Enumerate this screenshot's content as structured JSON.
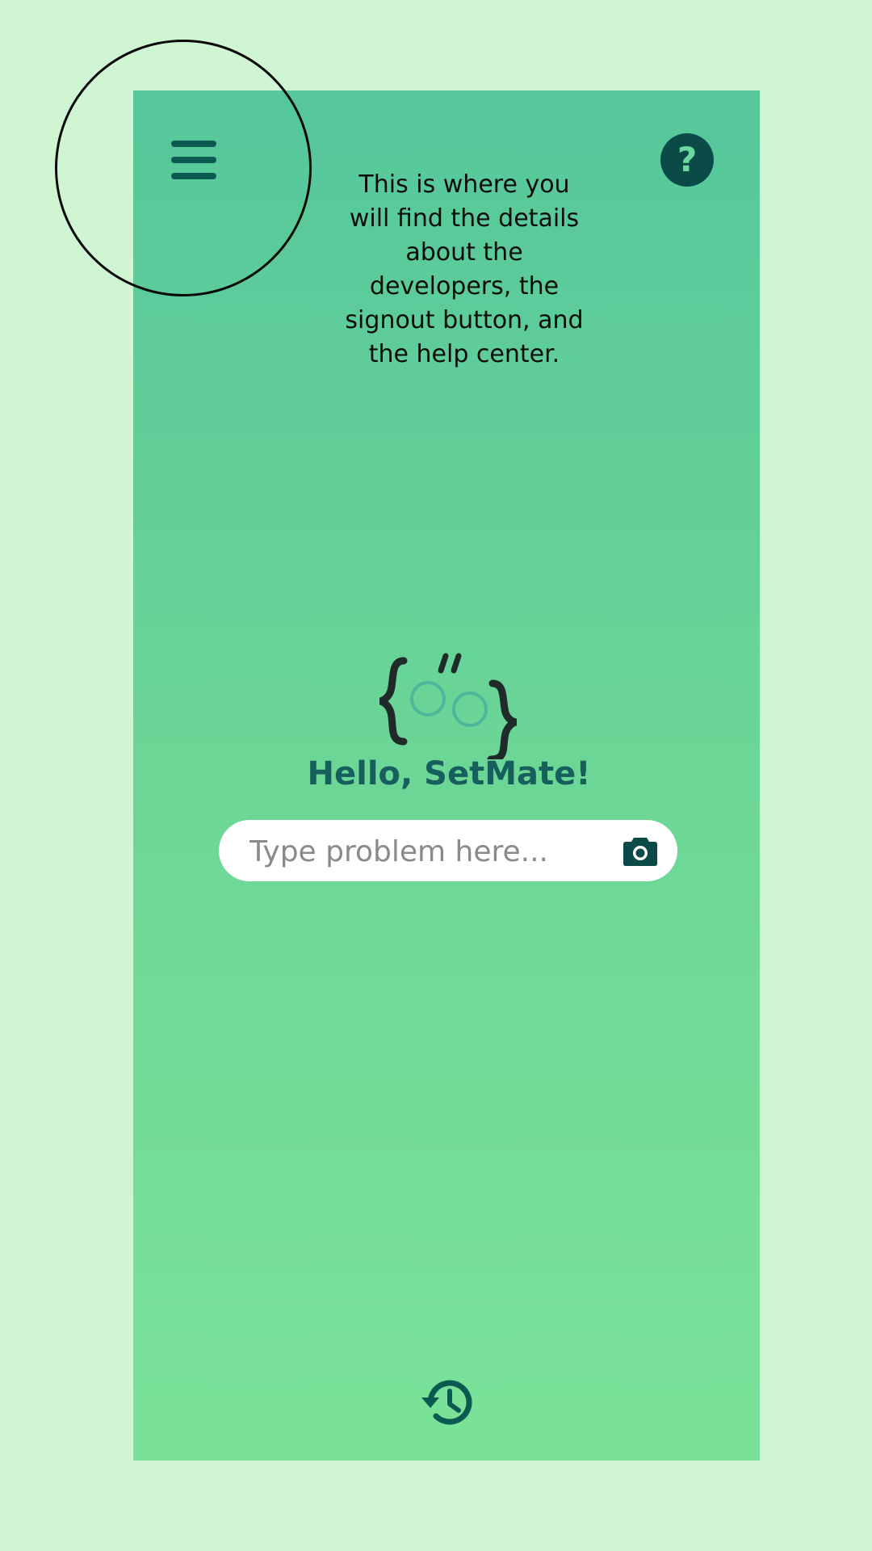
{
  "annotation": {
    "lines": [
      "This is where you",
      "will find the details",
      "about the",
      "developers, the",
      "signout button, and",
      "the help center."
    ]
  },
  "header": {
    "help_symbol": "?"
  },
  "main": {
    "greeting": "Hello, SetMate!",
    "search_placeholder": "Type problem here..."
  },
  "icons": {
    "menu": "hamburger-menu-icon",
    "help": "question-mark-icon",
    "camera": "camera-icon",
    "history": "history-icon",
    "logo": "setmate-logo"
  },
  "colors": {
    "page_background": "#cff5d3",
    "screen_gradient_top": "#55c79b",
    "screen_gradient_bottom": "#7ae298",
    "accent_dark": "#0b4b47",
    "greeting_text": "#165f5c",
    "highlight_ring": "#0a0a0a"
  }
}
